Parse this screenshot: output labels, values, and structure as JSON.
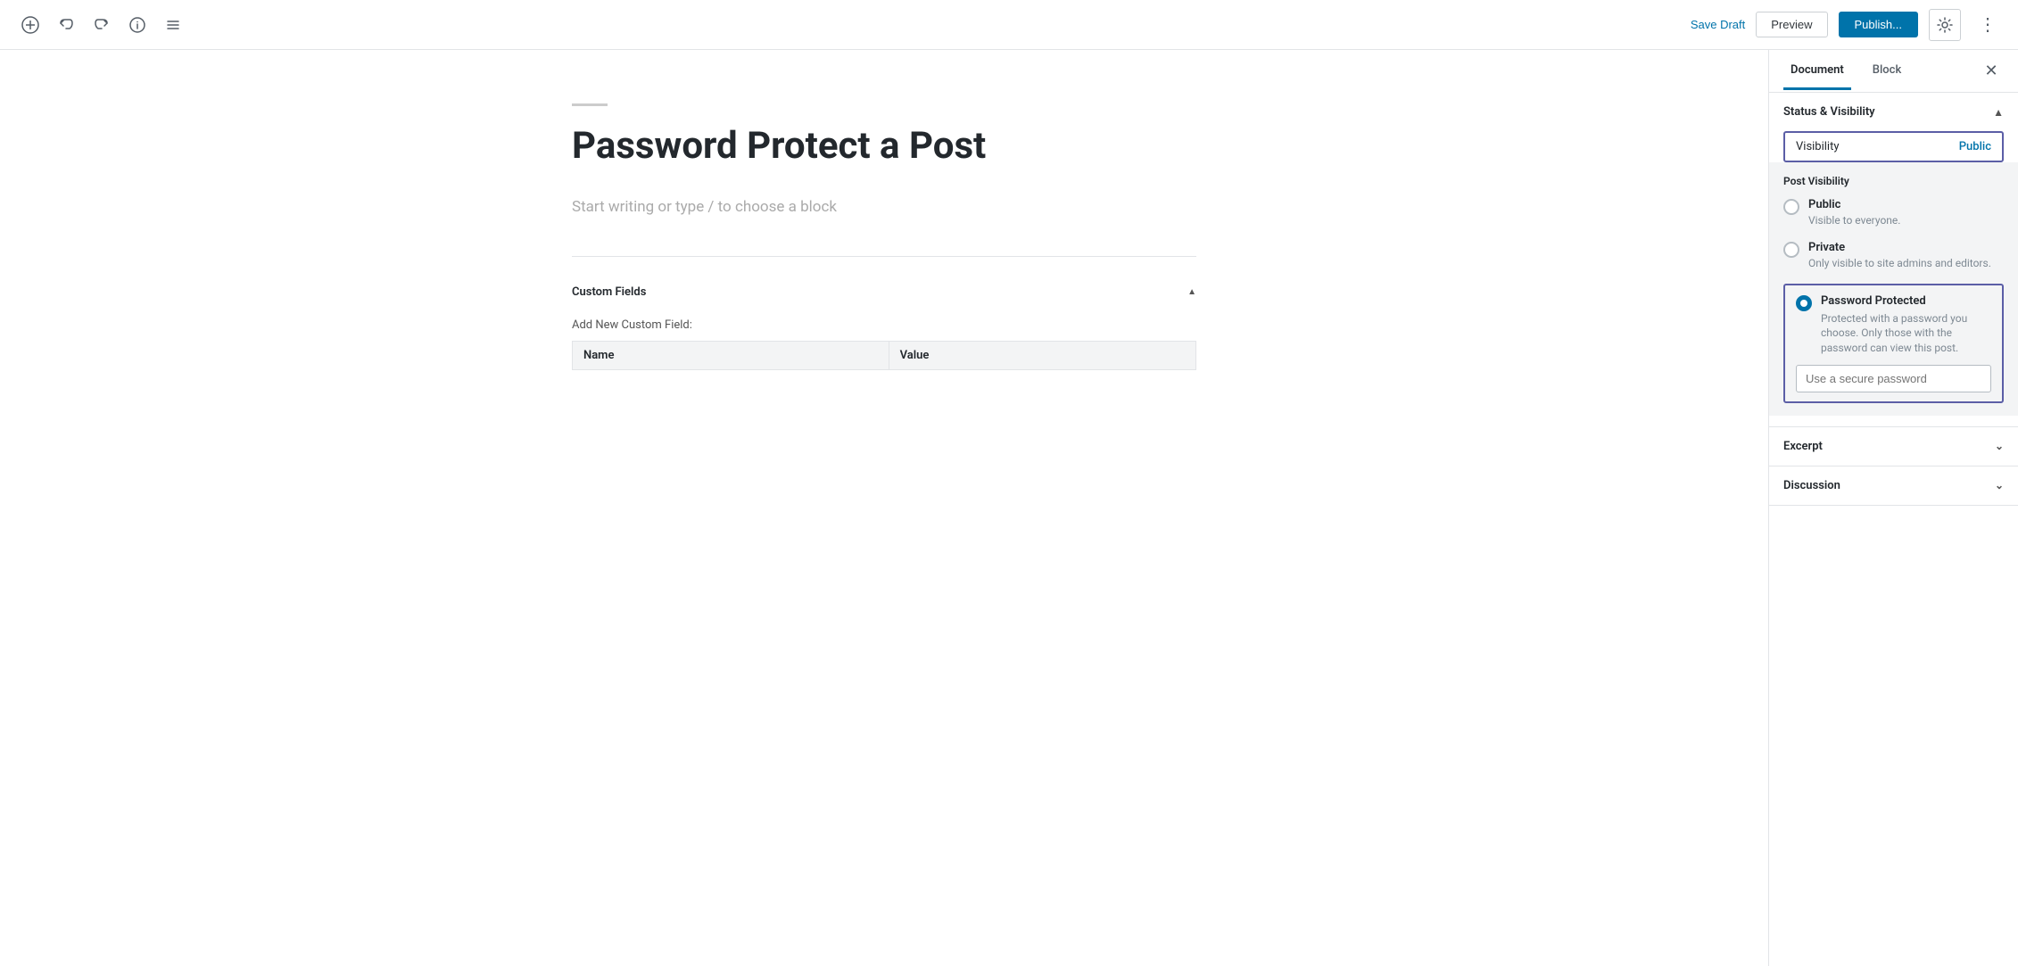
{
  "toolbar": {
    "save_draft_label": "Save Draft",
    "preview_label": "Preview",
    "publish_label": "Publish...",
    "document_tab": "Document",
    "block_tab": "Block"
  },
  "editor": {
    "post_title": "Password Protect a Post",
    "post_placeholder": "Start writing or type / to choose a block",
    "custom_fields_label": "Custom Fields",
    "add_new_custom_field_label": "Add New Custom Field:",
    "table_col_name": "Name",
    "table_col_value": "Value"
  },
  "sidebar": {
    "document_tab": "Document",
    "block_tab": "Block",
    "status_visibility_label": "Status & Visibility",
    "visibility_label": "Visibility",
    "visibility_value": "Public",
    "post_visibility_title": "Post Visibility",
    "options": [
      {
        "title": "Public",
        "desc": "Visible to everyone.",
        "selected": false
      },
      {
        "title": "Private",
        "desc": "Only visible to site admins and editors.",
        "selected": false
      },
      {
        "title": "Password Protected",
        "desc": "Protected with a password you choose. Only those with the password can view this post.",
        "selected": true
      }
    ],
    "password_placeholder": "Use a secure password",
    "excerpt_label": "Excerpt",
    "discussion_label": "Discussion"
  }
}
